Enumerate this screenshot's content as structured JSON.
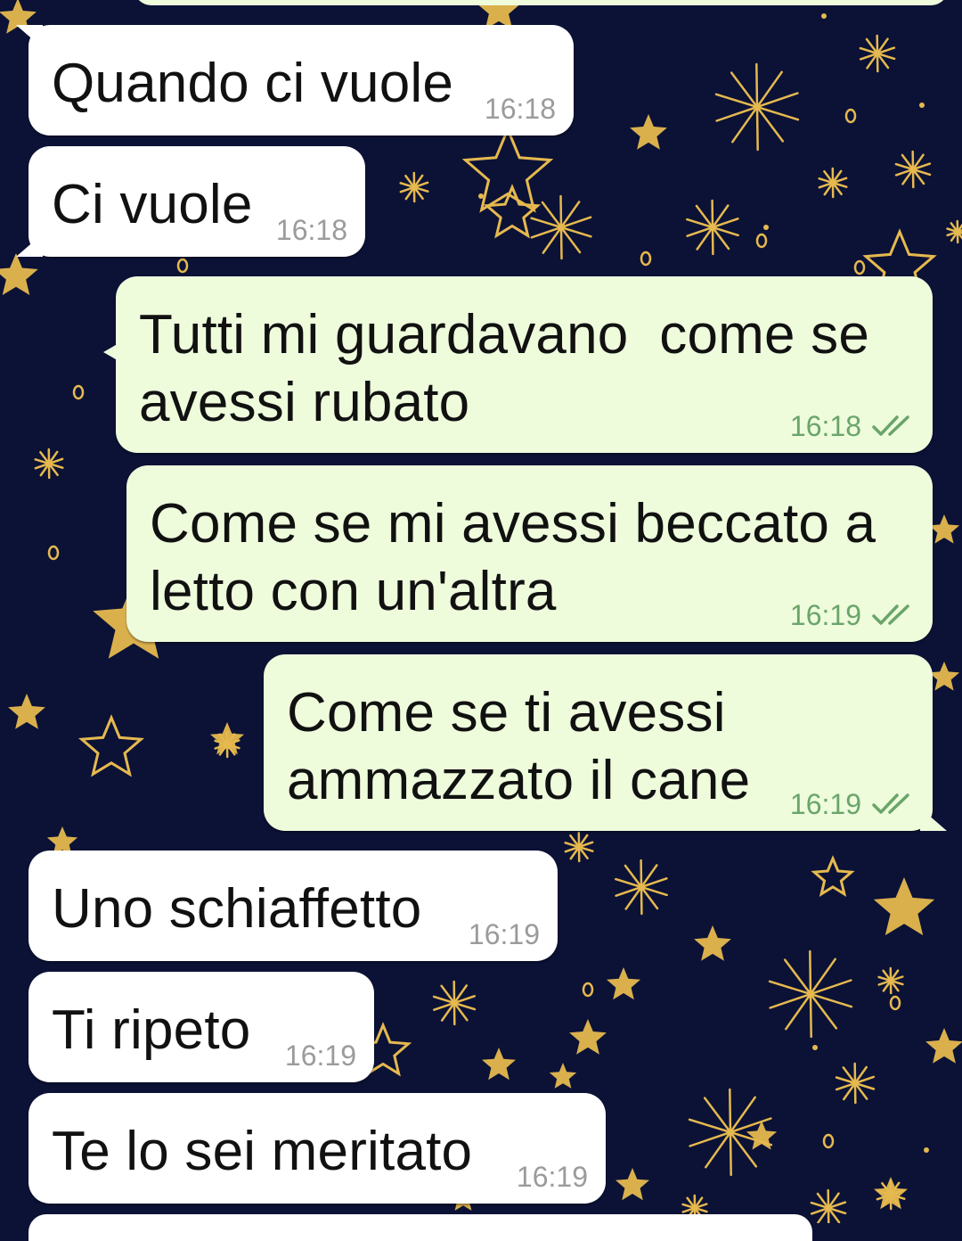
{
  "chat": {
    "messages": [
      {
        "direction": "in",
        "text": "Quando ci vuole",
        "time": "16:18"
      },
      {
        "direction": "in",
        "text": "Ci vuole",
        "time": "16:18"
      },
      {
        "direction": "out",
        "text": "Tutti mi guardavano  come se\navessi rubato",
        "time": "16:18",
        "read_receipt": "double-check-icon"
      },
      {
        "direction": "out",
        "text": "Come se mi avessi beccato a\nletto con un'altra",
        "time": "16:19",
        "read_receipt": "double-check-icon"
      },
      {
        "direction": "out",
        "text": "Come se ti avessi\nammazzato il cane",
        "time": "16:19",
        "read_receipt": "double-check-icon"
      },
      {
        "direction": "in",
        "text": "Uno schiaffetto",
        "time": "16:19"
      },
      {
        "direction": "in",
        "text": "Ti ripeto",
        "time": "16:19"
      },
      {
        "direction": "in",
        "text": "Te lo sei meritato",
        "time": "16:19"
      }
    ]
  },
  "colors": {
    "wallpaper": "#0b1236",
    "star_gold": "#e6b94f",
    "incoming_bubble": "#ffffff",
    "outgoing_bubble": "#eefcdc",
    "outgoing_meta": "#6aa56a",
    "incoming_meta": "#9b9b9b"
  }
}
